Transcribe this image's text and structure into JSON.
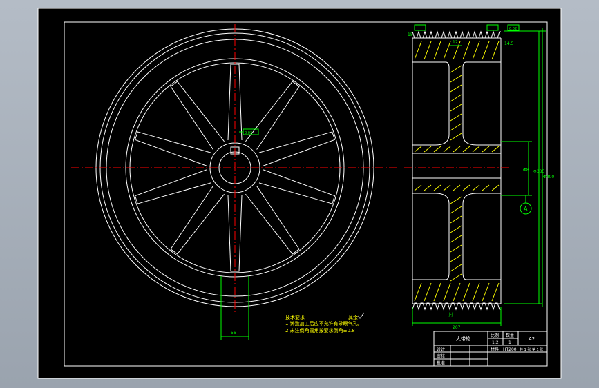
{
  "drawing": {
    "notes": {
      "title": "技术要求",
      "line1": "1.铸造加工后应不允许有砂眼气孔。",
      "line2": "2.未注倒角圆角按要求倒角±0.8"
    },
    "roughness_note": "其余",
    "section_label": "J-J",
    "datum_label": "A",
    "dims": {
      "hub_width": "56",
      "total_width": "207",
      "key_width": "12",
      "small_top": "15",
      "small_right": "14.5",
      "bore": "Φ8",
      "outer_dia": "Φ400",
      "pitch_dia": "Φ386",
      "tol_left": "0.02",
      "tol_right": "0.02"
    },
    "title_block": {
      "part_name": "大带轮",
      "scale_header": "比例",
      "qty_header": "数量",
      "scale_value": "1:2",
      "qty_value": "1",
      "sheet_size": "A2",
      "designer_label": "设计",
      "checker_label": "审核",
      "approver_label": "批准",
      "material_label": "材料",
      "material_value": "HT200",
      "sheet_info": "共 1 张 第 1 张"
    }
  },
  "colors": {
    "background": "#000000",
    "outline": "#ffffff",
    "centerline": "#ff0000",
    "dimension": "#00ff00",
    "hatch": "#ffff00"
  }
}
